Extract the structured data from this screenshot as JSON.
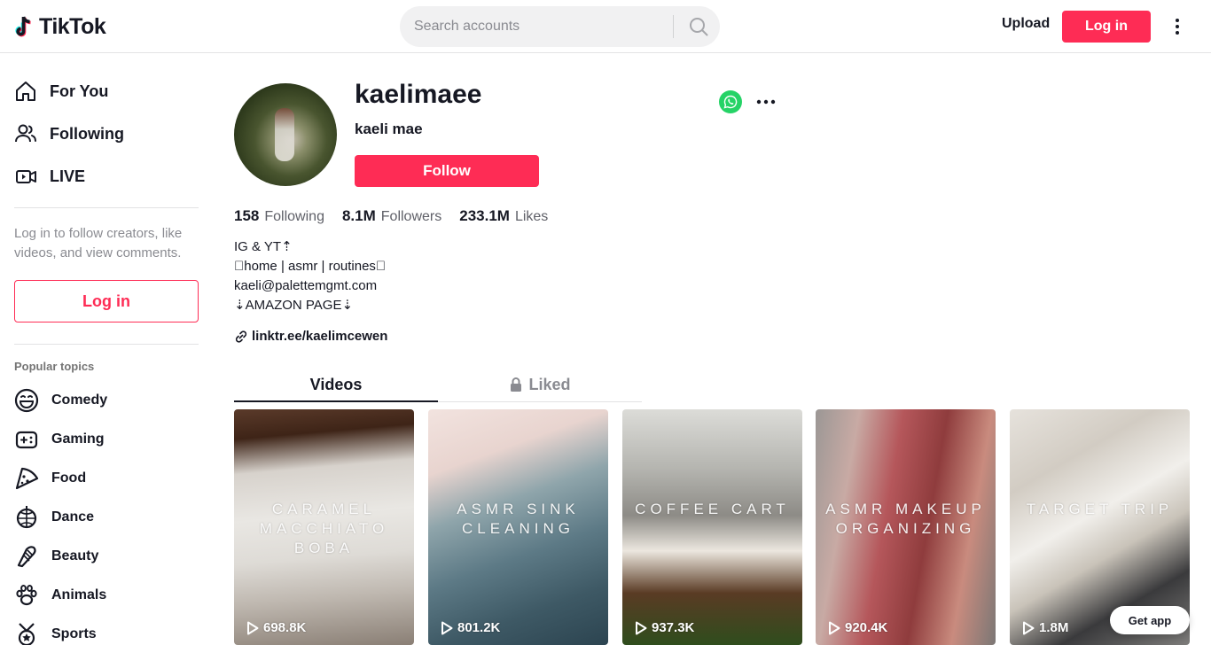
{
  "header": {
    "logo_text": "TikTok",
    "search_placeholder": "Search accounts",
    "upload_label": "Upload",
    "login_label": "Log in"
  },
  "sidebar": {
    "nav": [
      {
        "label": "For You",
        "icon": "home-icon"
      },
      {
        "label": "Following",
        "icon": "following-icon"
      },
      {
        "label": "LIVE",
        "icon": "live-icon"
      }
    ],
    "note": "Log in to follow creators, like videos, and view comments.",
    "login_label": "Log in",
    "topics_title": "Popular topics",
    "topics": [
      {
        "label": "Comedy",
        "icon": "comedy-icon"
      },
      {
        "label": "Gaming",
        "icon": "gaming-icon"
      },
      {
        "label": "Food",
        "icon": "food-icon"
      },
      {
        "label": "Dance",
        "icon": "dance-icon"
      },
      {
        "label": "Beauty",
        "icon": "beauty-icon"
      },
      {
        "label": "Animals",
        "icon": "animals-icon"
      },
      {
        "label": "Sports",
        "icon": "sports-icon"
      }
    ]
  },
  "profile": {
    "username": "kaelimaee",
    "nickname": "kaeli mae",
    "follow_label": "Follow",
    "stats": [
      {
        "value": "158",
        "label": "Following"
      },
      {
        "value": "8.1M",
        "label": "Followers"
      },
      {
        "value": "233.1M",
        "label": "Likes"
      }
    ],
    "bio": [
      "IG & YT⇡",
      "􀀀home | asmr | routines􀀀",
      "kaeli@palettemgmt.com",
      "⇣AMAZON PAGE⇣"
    ],
    "link": "linktr.ee/kaelimcewen"
  },
  "tabs": {
    "videos": "Videos",
    "liked": "Liked"
  },
  "videos": [
    {
      "caption": "CARAMEL MACCHIATO BOBA",
      "views": "698.8K"
    },
    {
      "caption": "ASMR SINK CLEANING",
      "views": "801.2K"
    },
    {
      "caption": "COFFEE CART",
      "views": "937.3K"
    },
    {
      "caption": "ASMR MAKEUP ORGANIZING",
      "views": "920.4K"
    },
    {
      "caption": "TARGET TRIP",
      "views": "1.8M"
    }
  ],
  "get_app_label": "Get app",
  "colors": {
    "brand": "#fe2c55",
    "whatsapp": "#25d366",
    "text": "#161823",
    "muted": "#8a8b91"
  }
}
